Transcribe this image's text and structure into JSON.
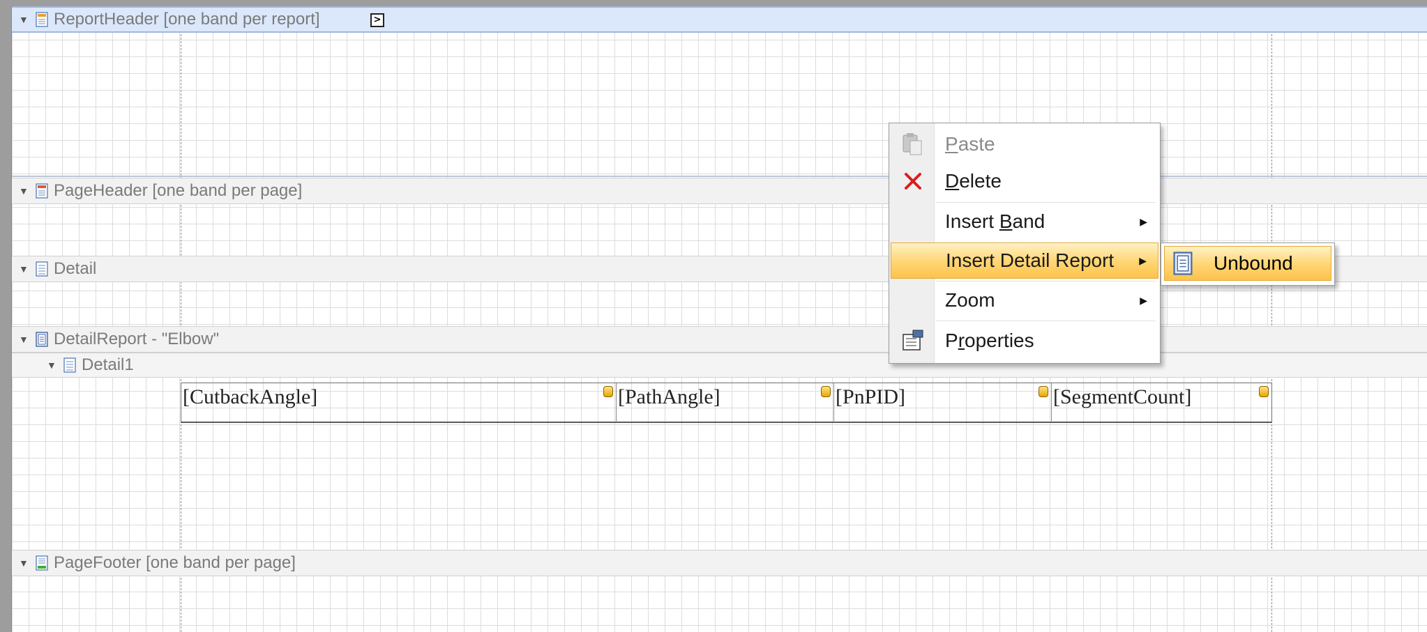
{
  "bands": [
    {
      "id": "report-header",
      "title": "ReportHeader [one band per report]",
      "icon": "report-header-icon"
    },
    {
      "id": "page-header",
      "title": "PageHeader [one band per page]",
      "icon": "page-header-icon"
    },
    {
      "id": "detail",
      "title": "Detail",
      "icon": "detail-band-icon"
    },
    {
      "id": "detail-report",
      "title": "DetailReport - \"Elbow\"",
      "icon": "detail-report-icon"
    },
    {
      "id": "detail1",
      "title": "Detail1",
      "icon": "detail-band-icon"
    },
    {
      "id": "page-footer",
      "title": "PageFooter [one band per page]",
      "icon": "page-footer-icon"
    }
  ],
  "fields": [
    "[CutbackAngle]",
    "[PathAngle]",
    "[PnPID]",
    "[SegmentCount]"
  ],
  "context_menu": {
    "items": [
      {
        "label_pre": "",
        "label_key": "P",
        "label_post": "aste",
        "disabled": true,
        "icon": "paste-icon"
      },
      {
        "label_pre": "",
        "label_key": "D",
        "label_post": "elete",
        "disabled": false,
        "icon": "delete-icon"
      },
      {
        "label_pre": "Insert ",
        "label_key": "B",
        "label_post": "and",
        "has_submenu": true
      },
      {
        "label_pre": "Insert Detail Report",
        "label_key": "",
        "label_post": "",
        "has_submenu": true,
        "highlighted": true
      },
      {
        "label_pre": "Zoom",
        "label_key": "",
        "label_post": "",
        "has_submenu": true
      },
      {
        "label_pre": "P",
        "label_key": "r",
        "label_post": "operties",
        "icon": "properties-icon"
      }
    ]
  },
  "submenu": {
    "label": "Unbound",
    "icon": "detail-report-icon"
  },
  "colors": {
    "highlight": "#ffd777",
    "selected_band": "#dbe7fb",
    "delete": "#d62020"
  }
}
